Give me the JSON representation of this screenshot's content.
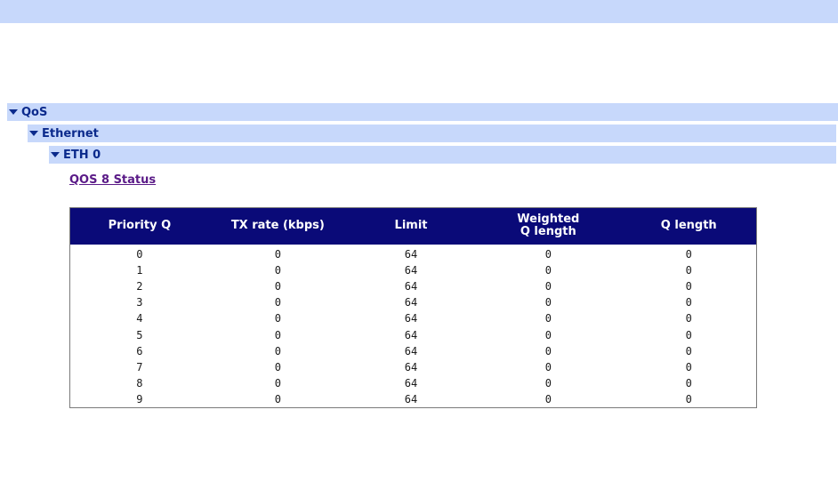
{
  "tree": {
    "qos": "QoS",
    "ethernet": "Ethernet",
    "eth0": "ETH 0"
  },
  "link": {
    "status": "QOS 8 Status"
  },
  "table": {
    "headers": {
      "priority": "Priority Q",
      "tx_rate": "TX rate (kbps)",
      "limit": "Limit",
      "weighted_line1": "Weighted",
      "weighted_line2": "Q length",
      "qlength": "Q length"
    },
    "rows": [
      [
        "0",
        "0",
        "64",
        "0",
        "0"
      ],
      [
        "1",
        "0",
        "64",
        "0",
        "0"
      ],
      [
        "2",
        "0",
        "64",
        "0",
        "0"
      ],
      [
        "3",
        "0",
        "64",
        "0",
        "0"
      ],
      [
        "4",
        "0",
        "64",
        "0",
        "0"
      ],
      [
        "5",
        "0",
        "64",
        "0",
        "0"
      ],
      [
        "6",
        "0",
        "64",
        "0",
        "0"
      ],
      [
        "7",
        "0",
        "64",
        "0",
        "0"
      ],
      [
        "8",
        "0",
        "64",
        "0",
        "0"
      ],
      [
        "9",
        "0",
        "64",
        "0",
        "0"
      ]
    ]
  },
  "colors": {
    "nav_bg": "#c7d8fb",
    "header_bg": "#0a0a78",
    "link": "#5a1a87",
    "tree_text": "#0b2a8c"
  }
}
